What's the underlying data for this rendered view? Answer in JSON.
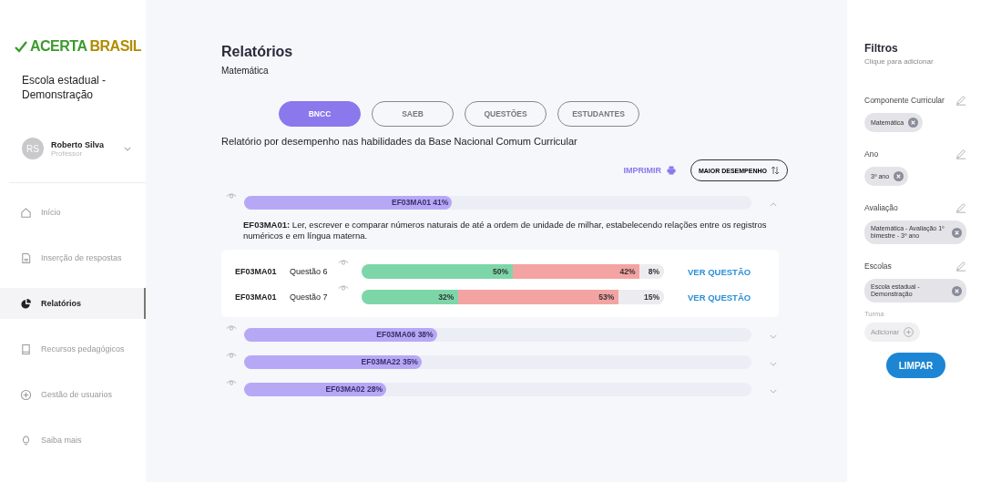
{
  "logo": {
    "part1": "ACERTA",
    "part2": "BRASIL"
  },
  "sidebar": {
    "school": "Escola estadual - Demonstração",
    "user": {
      "initials": "RS",
      "name": "Roberto Silva",
      "role": "Professor"
    },
    "items": [
      {
        "label": "Início",
        "selected": false
      },
      {
        "label": "Inserção de respostas",
        "selected": false
      },
      {
        "label": "Relatórios",
        "selected": true
      },
      {
        "label": "Recursos pedagógicos",
        "selected": false
      },
      {
        "label": "Gestão de usuarios",
        "selected": false
      },
      {
        "label": "Saiba mais",
        "selected": false
      }
    ]
  },
  "header": {
    "title": "Relatórios",
    "subtitle": "Matemática"
  },
  "tabs": [
    {
      "label": "BNCC",
      "selected": true
    },
    {
      "label": "SAEB",
      "selected": false
    },
    {
      "label": "QUESTÕES",
      "selected": false
    },
    {
      "label": "ESTUDANTES",
      "selected": false
    }
  ],
  "description": "Relatório por desempenho nas habilidades da Base Nacional Comum Curricular",
  "actions": {
    "print": "IMPRIMIR",
    "sort": "MAIOR DESEMPENHO"
  },
  "skills": [
    {
      "label": "EF03MA01 41%",
      "level": 0.41,
      "expanded": true,
      "text": "**EF03MA01:** Ler, escrever e comparar números naturais de até a ordem de unidade de milhar, estabelecendo relações entre os registros numéricos e em língua materna.",
      "questions": [
        {
          "code": "EF03MA01",
          "label": "Questão 6",
          "link": "VER QUESTÃO",
          "segments": [
            {
              "kind": "correct",
              "label": "50%"
            },
            {
              "kind": "wrong",
              "label": "42%"
            },
            {
              "kind": "blank",
              "label": "8%"
            }
          ]
        },
        {
          "code": "EF03MA01",
          "label": "Questão 7",
          "link": "VER QUESTÃO",
          "segments": [
            {
              "kind": "correct",
              "label": "32%"
            },
            {
              "kind": "wrong",
              "label": "53%"
            },
            {
              "kind": "blank",
              "label": "15%"
            }
          ]
        }
      ]
    },
    {
      "label": "EF03MA06 38%",
      "level": 0.38,
      "expanded": false
    },
    {
      "label": "EF03MA22 35%",
      "level": 0.35,
      "expanded": false
    },
    {
      "label": "EF03MA02 28%",
      "level": 0.28,
      "expanded": false
    }
  ],
  "filters": {
    "title": "Filtros",
    "subtitle": "Clique para adicionar",
    "clear": "LIMPAR",
    "groups": [
      {
        "kind": "chips",
        "label": "Componente Curricular",
        "chips": [
          "Matemática"
        ]
      },
      {
        "kind": "chips",
        "label": "Ano",
        "chips": [
          "3º ano"
        ]
      },
      {
        "kind": "chips",
        "label": "Avaliação",
        "chips": [
          "Matemática - Avaliação 1º bimestre - 3º ano"
        ]
      },
      {
        "kind": "chips",
        "label": "Escolas",
        "chips": [
          "Escola estadual - Demonstração"
        ]
      },
      {
        "kind": "add",
        "label": "Turma",
        "button": "Adicionar"
      }
    ]
  }
}
